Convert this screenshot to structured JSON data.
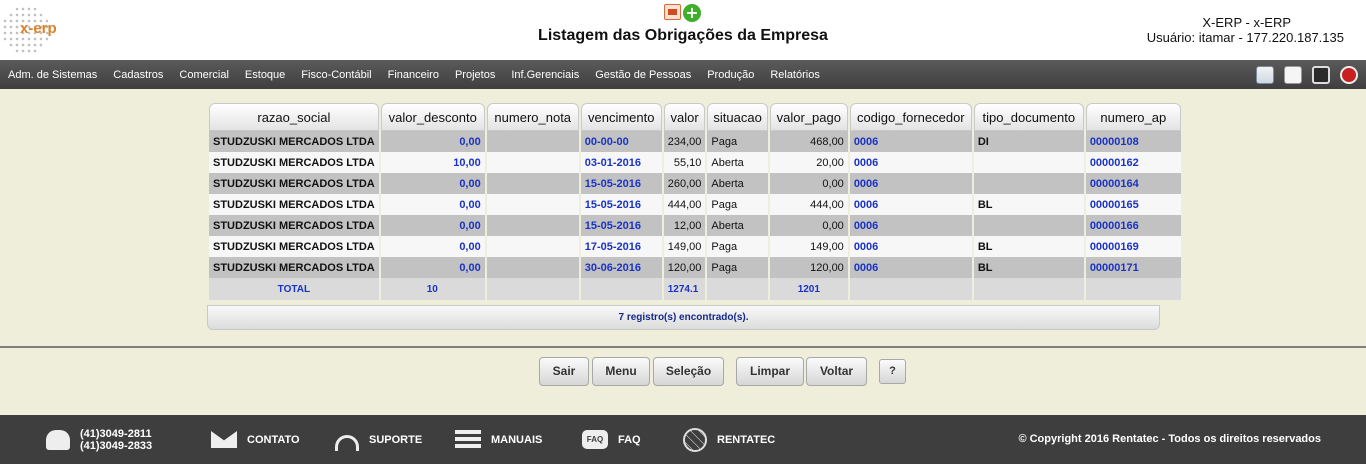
{
  "header": {
    "logo_text": "x-erp",
    "title": "Listagem das Obrigações da Empresa",
    "system_name": "X-ERP - x-ERP",
    "user_info": "Usuário: itamar - 177.220.187.135",
    "icons": [
      "report-icon",
      "add-icon"
    ]
  },
  "menu": {
    "items": [
      "Adm. de Sistemas",
      "Cadastros",
      "Comercial",
      "Estoque",
      "Fisco-Contábil",
      "Financeiro",
      "Projetos",
      "Inf.Gerenciais",
      "Gestão de Pessoas",
      "Produção",
      "Relatórios"
    ],
    "icons": [
      "home-icon",
      "document-icon",
      "print-icon",
      "power-icon"
    ]
  },
  "table": {
    "columns": [
      "razao_social",
      "valor_desconto",
      "numero_nota",
      "vencimento",
      "valor",
      "situacao",
      "valor_pago",
      "codigo_fornecedor",
      "tipo_documento",
      "numero_ap"
    ],
    "rows": [
      {
        "razao_social": "STUDZUSKI MERCADOS LTDA",
        "valor_desconto": "0,00",
        "numero_nota": "",
        "vencimento": "00-00-00",
        "valor": "234,00",
        "situacao": "Paga",
        "valor_pago": "468,00",
        "codigo_fornecedor": "0006",
        "tipo_documento": "DI",
        "numero_ap": "00000108"
      },
      {
        "razao_social": "STUDZUSKI MERCADOS LTDA",
        "valor_desconto": "10,00",
        "numero_nota": "",
        "vencimento": "03-01-2016",
        "valor": "55,10",
        "situacao": "Aberta",
        "valor_pago": "20,00",
        "codigo_fornecedor": "0006",
        "tipo_documento": "",
        "numero_ap": "00000162"
      },
      {
        "razao_social": "STUDZUSKI MERCADOS LTDA",
        "valor_desconto": "0,00",
        "numero_nota": "",
        "vencimento": "15-05-2016",
        "valor": "260,00",
        "situacao": "Aberta",
        "valor_pago": "0,00",
        "codigo_fornecedor": "0006",
        "tipo_documento": "",
        "numero_ap": "00000164"
      },
      {
        "razao_social": "STUDZUSKI MERCADOS LTDA",
        "valor_desconto": "0,00",
        "numero_nota": "",
        "vencimento": "15-05-2016",
        "valor": "444,00",
        "situacao": "Paga",
        "valor_pago": "444,00",
        "codigo_fornecedor": "0006",
        "tipo_documento": "BL",
        "numero_ap": "00000165"
      },
      {
        "razao_social": "STUDZUSKI MERCADOS LTDA",
        "valor_desconto": "0,00",
        "numero_nota": "",
        "vencimento": "15-05-2016",
        "valor": "12,00",
        "situacao": "Aberta",
        "valor_pago": "0,00",
        "codigo_fornecedor": "0006",
        "tipo_documento": "",
        "numero_ap": "00000166"
      },
      {
        "razao_social": "STUDZUSKI MERCADOS LTDA",
        "valor_desconto": "0,00",
        "numero_nota": "",
        "vencimento": "17-05-2016",
        "valor": "149,00",
        "situacao": "Paga",
        "valor_pago": "149,00",
        "codigo_fornecedor": "0006",
        "tipo_documento": "BL",
        "numero_ap": "00000169"
      },
      {
        "razao_social": "STUDZUSKI MERCADOS LTDA",
        "valor_desconto": "0,00",
        "numero_nota": "",
        "vencimento": "30-06-2016",
        "valor": "120,00",
        "situacao": "Paga",
        "valor_pago": "120,00",
        "codigo_fornecedor": "0006",
        "tipo_documento": "BL",
        "numero_ap": "00000171"
      }
    ],
    "total": {
      "label": "TOTAL",
      "valor_desconto": "10",
      "valor": "1274.1",
      "valor_pago": "1201"
    },
    "records_text": "7 registro(s) encontrado(s)."
  },
  "buttons": {
    "sair": "Sair",
    "menu": "Menu",
    "selecao": "Seleção",
    "limpar": "Limpar",
    "voltar": "Voltar",
    "help": "?"
  },
  "footer": {
    "phone1": "(41)3049-2811",
    "phone2": "(41)3049-2833",
    "contato": "CONTATO",
    "suporte": "SUPORTE",
    "manuais": "MANUAIS",
    "faq": "FAQ",
    "faq_icon_text": "FAQ",
    "rentatec": "RENTATEC",
    "copyright": "© Copyright 2016 Rentatec - Todos os direitos reservados"
  }
}
